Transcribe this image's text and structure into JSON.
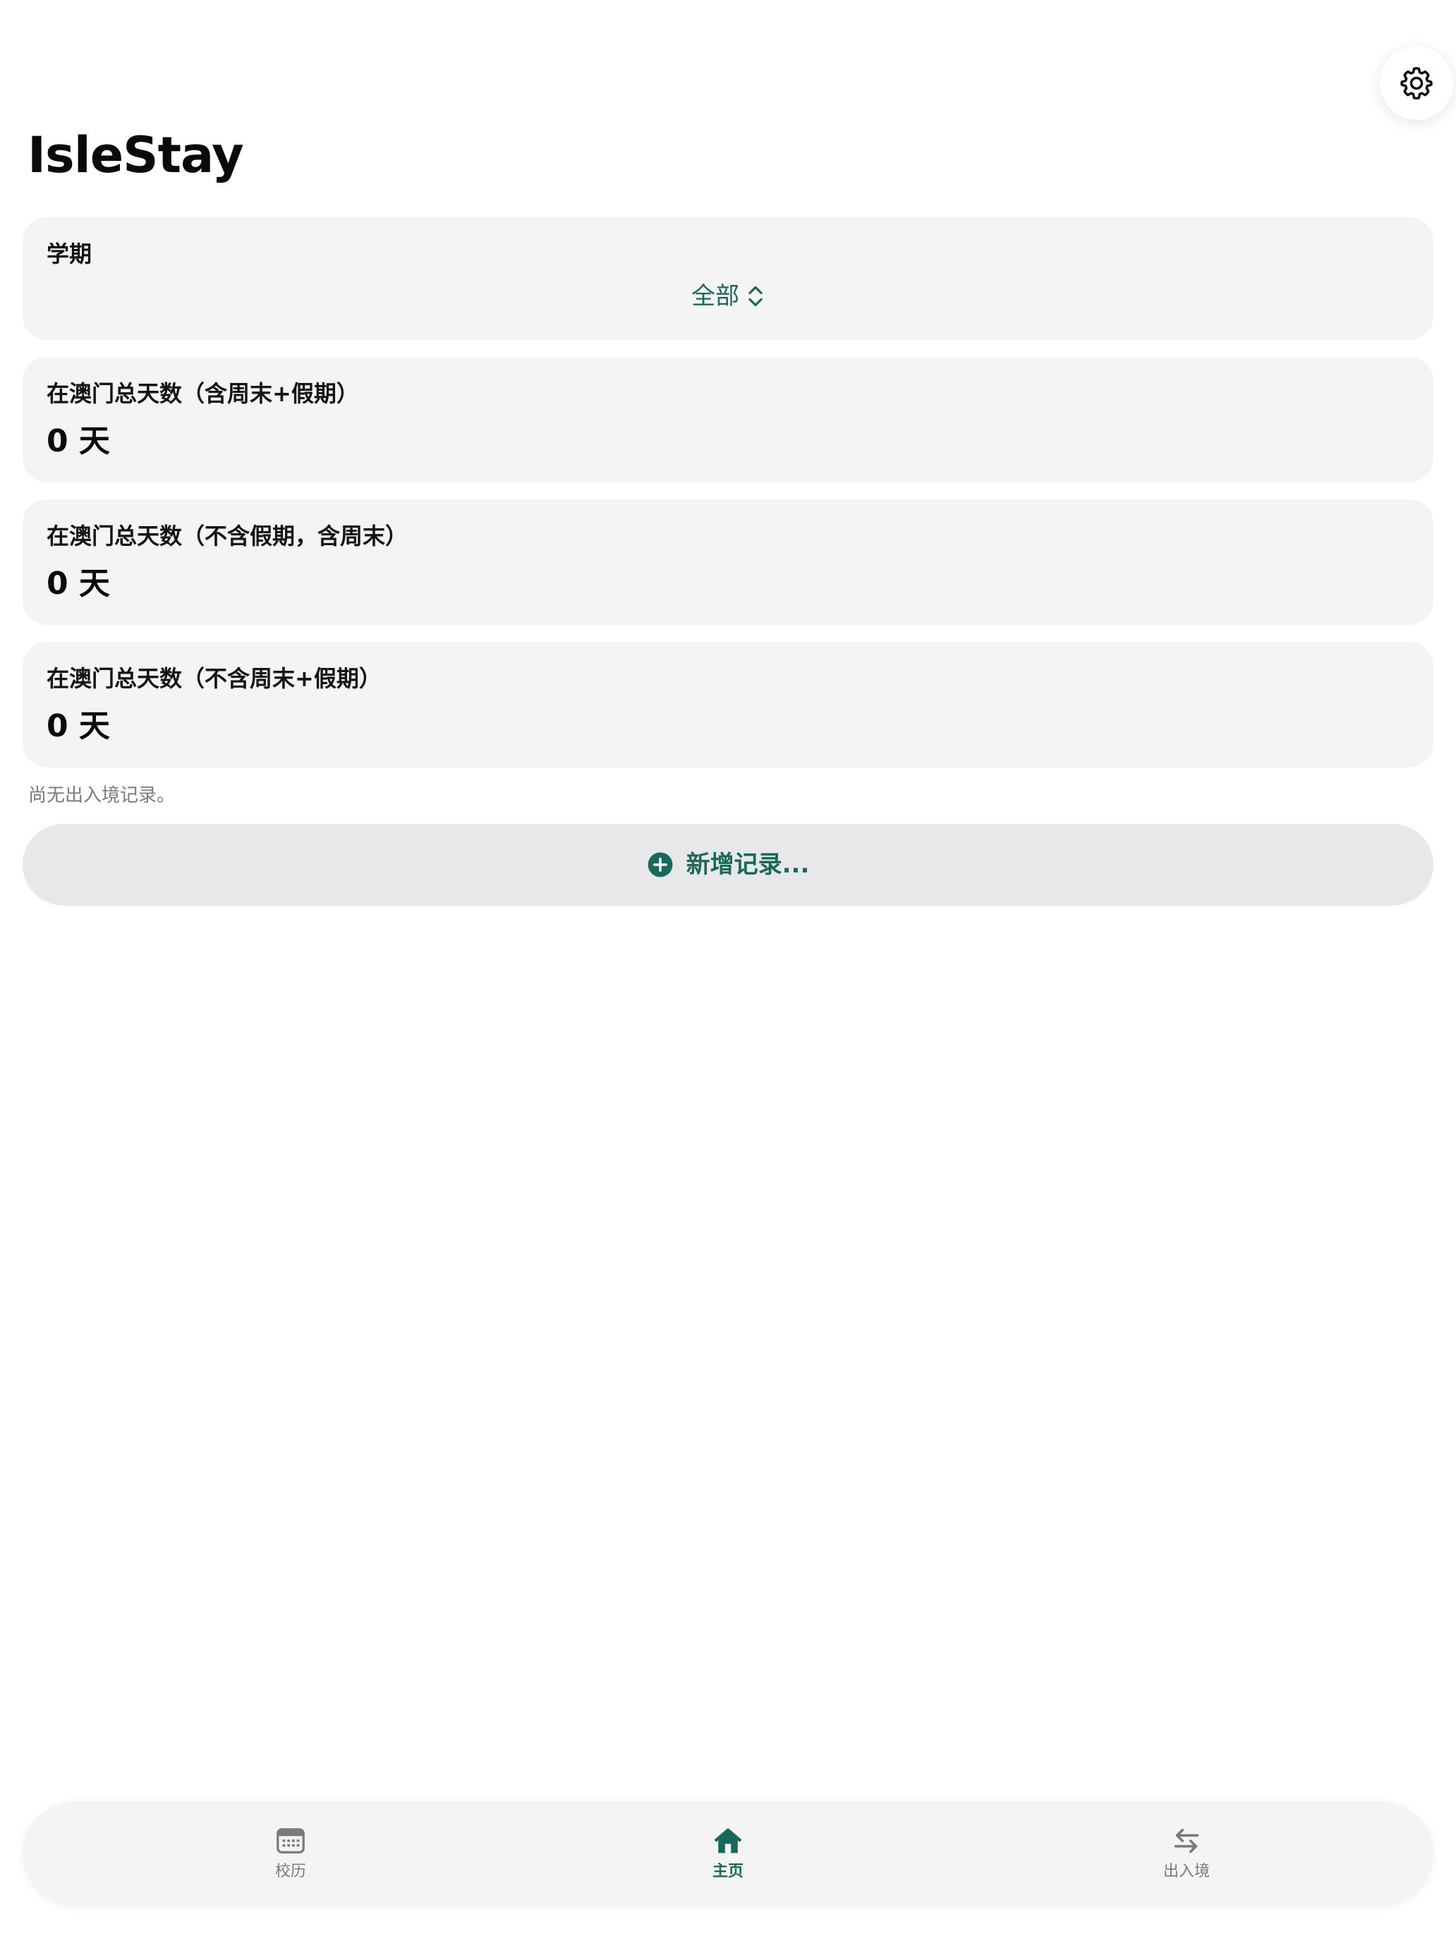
{
  "app": {
    "title": "IsleStay"
  },
  "colors": {
    "accent": "#17695a",
    "card_bg": "#f4f4f4",
    "button_bg": "#e8e8ea",
    "muted_text": "#7b7b7b"
  },
  "icons": {
    "settings": "gear-icon",
    "semester_picker": "chevron-up-down-icon",
    "add_record": "plus-circle-icon",
    "tab_calendar": "calendar-icon",
    "tab_home": "home-icon",
    "tab_border": "arrows-left-right-icon"
  },
  "semester": {
    "label": "学期",
    "selected": "全部"
  },
  "stats": [
    {
      "label": "在澳门总天数（含周末+假期）",
      "value": "0 天"
    },
    {
      "label": "在澳门总天数（不含假期，含周末）",
      "value": "0 天"
    },
    {
      "label": "在澳门总天数（不含周末+假期）",
      "value": "0 天"
    }
  ],
  "records": {
    "empty_message": "尚无出入境记录。",
    "add_button_label": "新增记录..."
  },
  "tabs": [
    {
      "label": "校历",
      "active": false
    },
    {
      "label": "主页",
      "active": true
    },
    {
      "label": "出入境",
      "active": false
    }
  ]
}
